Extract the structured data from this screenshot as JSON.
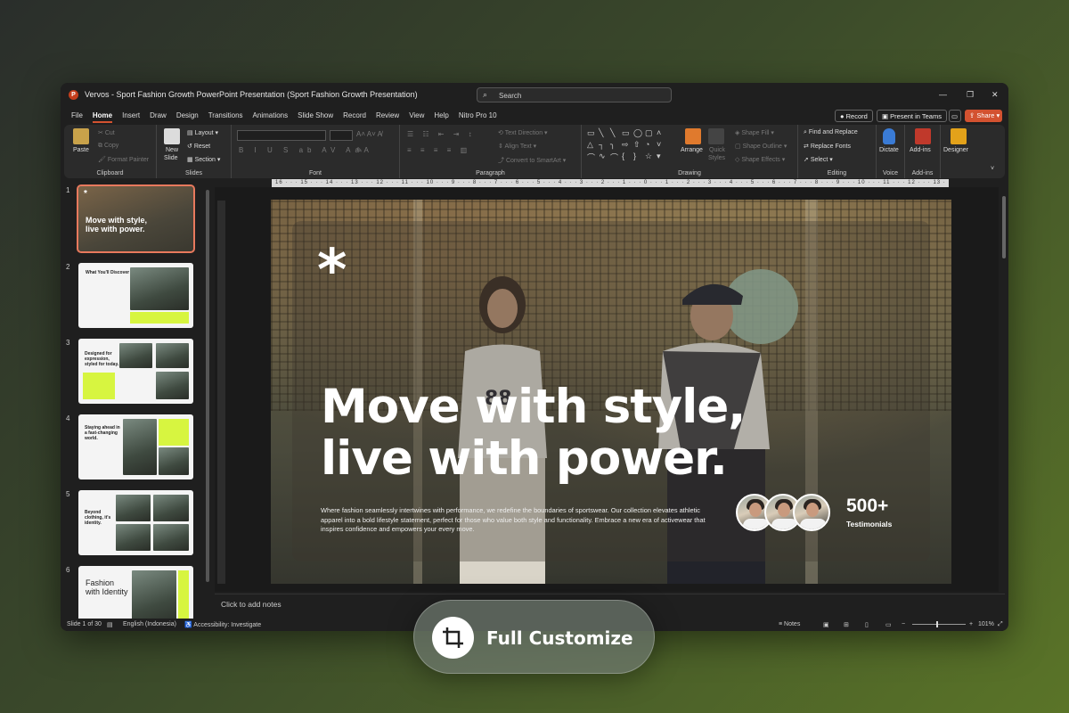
{
  "window": {
    "title": "Vervos - Sport Fashion Growth PowerPoint Presentation (Sport Fashion Growth Presentation)",
    "search_placeholder": "Search"
  },
  "menu": {
    "tabs": [
      "File",
      "Home",
      "Insert",
      "Draw",
      "Design",
      "Transitions",
      "Animations",
      "Slide Show",
      "Record",
      "Review",
      "View",
      "Help",
      "Nitro Pro 10"
    ],
    "active_tab": "Home",
    "record_label": "Record",
    "present_label": "Present in Teams",
    "share_label": "Share"
  },
  "ribbon": {
    "clipboard": {
      "paste": "Paste",
      "cut": "Cut",
      "copy": "Copy",
      "format_painter": "Format Painter",
      "label": "Clipboard"
    },
    "slides": {
      "new_slide_1": "New",
      "new_slide_2": "Slide",
      "layout": "Layout",
      "reset": "Reset",
      "section": "Section",
      "label": "Slides"
    },
    "font": {
      "label": "Font"
    },
    "paragraph": {
      "text_direction": "Text Direction",
      "align_text": "Align Text",
      "convert": "Convert to SmartArt",
      "label": "Paragraph"
    },
    "drawing": {
      "arrange": "Arrange",
      "quick_styles_1": "Quick",
      "quick_styles_2": "Styles",
      "shape_fill": "Shape Fill",
      "shape_outline": "Shape Outline",
      "shape_effects": "Shape Effects",
      "label": "Drawing"
    },
    "editing": {
      "find_replace": "Find and Replace",
      "replace_fonts": "Replace Fonts",
      "select": "Select",
      "label": "Editing"
    },
    "voice": {
      "dictate": "Dictate",
      "label": "Voice"
    },
    "addins": {
      "addins": "Add-ins",
      "label": "Add-ins"
    },
    "designer": {
      "label": "Designer"
    }
  },
  "ruler": {
    "text": "16 · · · 15 · · · 14 · · · 13 · · · 12 · · · 11 · · · 10 · · · 9 · · · 8 · · · 7 · · · 6 · · · 5 · · · 4 · · · 3 · · · 2 · · · 1 · · · 0 · · · 1 · · · 2 · · · 3 · · · 4 · · · 5 · · · 6 · · · 7 · · · 8 · · · 9 · · · 10 · · · 11 · · · 12 · · · 13 · · · 14 · · · 15 · · · 16"
  },
  "thumbnails": [
    {
      "num": "1",
      "title": "Move with style, live with power."
    },
    {
      "num": "2",
      "title": "What You'll Discover"
    },
    {
      "num": "3",
      "title": "Designed for expression, styled for today."
    },
    {
      "num": "4",
      "title": "Staying ahead in a fast-changing world."
    },
    {
      "num": "5",
      "title": "Beyond clothing, it's identity."
    },
    {
      "num": "6",
      "title": "Fashion with Identity"
    }
  ],
  "slide": {
    "asterisk": "*",
    "headline": "Move with style, live with power.",
    "body": "Where fashion seamlessly intertwines with performance, we redefine the boundaries of sportswear. Our collection elevates athletic apparel into a bold lifestyle statement, perfect for those who value both style and functionality. Embrace a new era of activewear that inspires confidence and empowers your every move.",
    "count": "500+",
    "count_label": "Testimonials"
  },
  "notes_placeholder": "Click to add notes",
  "status": {
    "slide_of": "Slide 1 of 30",
    "language": "English (Indonesia)",
    "accessibility": "Accessibility: Investigate",
    "notes": "Notes",
    "zoom": "101%"
  },
  "promo": {
    "label": "Full Customize"
  },
  "colors": {
    "accent": "#d35230",
    "lime": "#d7f540"
  }
}
